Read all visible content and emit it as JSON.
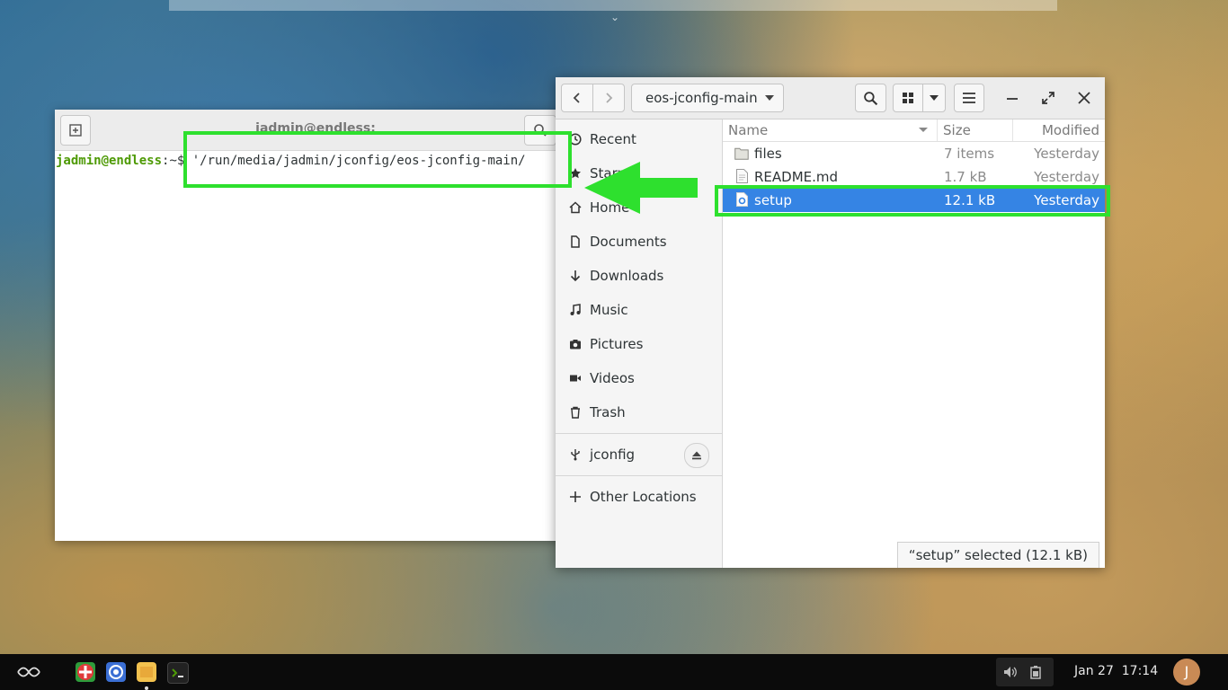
{
  "terminal": {
    "title": "jadmin@endless:",
    "prompt_user": "jadmin@endless",
    "prompt_suffix": ":~$ ",
    "command": "'/run/media/jadmin/jconfig/eos-jconfig-main/"
  },
  "files": {
    "path_button": "eos-jconfig-main",
    "sidebar": {
      "recent": "Recent",
      "starred": "Starred",
      "home": "Home",
      "documents": "Documents",
      "downloads": "Downloads",
      "music": "Music",
      "pictures": "Pictures",
      "videos": "Videos",
      "trash": "Trash",
      "jconfig": "jconfig",
      "other_locations": "Other Locations"
    },
    "columns": {
      "name": "Name",
      "size": "Size",
      "modified": "Modified"
    },
    "rows": [
      {
        "name": "files",
        "size": "7 items",
        "modified": "Yesterday",
        "icon": "folder-icon"
      },
      {
        "name": "README.md",
        "size": "1.7 kB",
        "modified": "Yesterday",
        "icon": "text-file-icon"
      },
      {
        "name": "setup",
        "size": "12.1 kB",
        "modified": "Yesterday",
        "icon": "script-file-icon",
        "selected": true
      }
    ],
    "status": "“setup” selected  (12.1 kB)"
  },
  "taskbar": {
    "date": "Jan 27",
    "time": "17:14",
    "avatar_letter": "J"
  },
  "colors": {
    "annotation": "#2ee02e",
    "selection": "#3584e4",
    "prompt": "#4e9a06"
  }
}
